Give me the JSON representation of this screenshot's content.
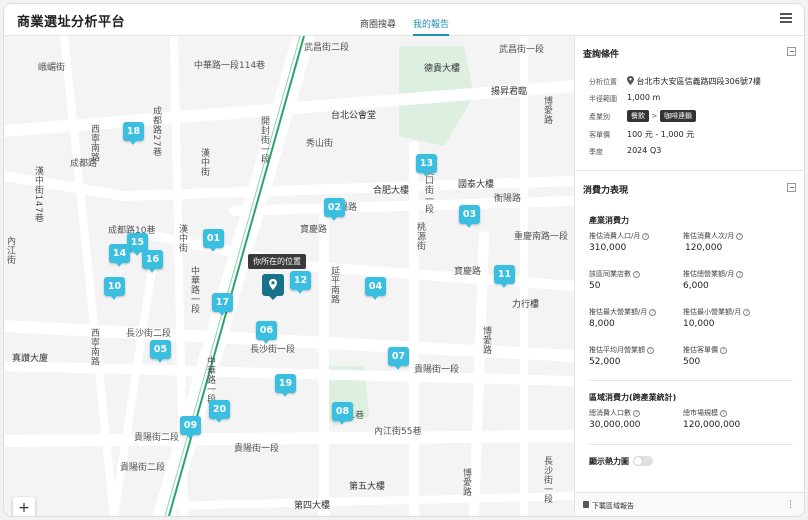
{
  "header": {
    "brand": "商業選址分析平台",
    "tabs": [
      {
        "label": "商圈搜尋",
        "active": false
      },
      {
        "label": "我的報告",
        "active": true
      }
    ]
  },
  "map": {
    "markers": [
      "18",
      "13",
      "02",
      "03",
      "01",
      "15",
      "14",
      "16",
      "12",
      "04",
      "11",
      "10",
      "17",
      "06",
      "05",
      "07",
      "19",
      "20",
      "09",
      "08"
    ],
    "you_are_here": "你所在的位置",
    "pois": [
      "德貴大樓",
      "揚昇君臨",
      "台北公會堂",
      "合肥大樓",
      "國泰大樓",
      "力行樓",
      "真讚大廈",
      "第五大樓",
      "第四大樓"
    ],
    "streets": [
      "峨嵋街",
      "中華路一段114巷",
      "武昌街一段",
      "成都路",
      "成都路27巷",
      "寶慶路",
      "衡陽路",
      "秀山街",
      "延平南路",
      "長沙街一段",
      "長沙街二段",
      "貴陽街一段",
      "貴陽街二段",
      "博愛路",
      "重慶南路一段",
      "西寧南路",
      "漢中街",
      "內江街",
      "開封街一段",
      "中華路一段",
      "武昌街二段",
      "桃源街",
      "漢口街一段",
      "延平南路",
      "121巷",
      "懷寧街",
      "長沙街一段",
      "貴陽街一段",
      "內江街55巷",
      "成都路10巷",
      "漢中街147巷"
    ],
    "zoom_in": "+",
    "zoom_out": "−"
  },
  "query": {
    "title": "查詢條件",
    "location_label": "分析位置",
    "location_value": "台北市大安區信義路四段306號7樓",
    "radius_label": "半徑範圍",
    "radius_value": "1,000 m",
    "industry_label": "產業別",
    "industry_chip1": "餐飲",
    "industry_sep": ">",
    "industry_chip2": "咖啡連鎖",
    "price_label": "客單價",
    "price_value": "100 元 - 1,000 元",
    "season_label": "季度",
    "season_value": "2024 Q3"
  },
  "consumption": {
    "title": "消費力表現",
    "industry_sub": "產業消費力",
    "metrics": [
      {
        "label": "推估消費人口/月",
        "value": "310,000"
      },
      {
        "label": "推估消費人次/月",
        "value": "120,000"
      },
      {
        "label": "該區同業店數",
        "value": "50"
      },
      {
        "label": "推估總營業額/月",
        "value": "6,000"
      },
      {
        "label": "推估最大營業額/月",
        "value": "8,000"
      },
      {
        "label": "推估最小營業額/月",
        "value": "10,000"
      },
      {
        "label": "推估平均月營業額",
        "value": "52,000"
      },
      {
        "label": "推估客單價",
        "value": "500"
      }
    ],
    "region_sub": "區域消費力(跨產業統計)",
    "region_metrics": [
      {
        "label": "總消費人口數",
        "value": "30,000,000"
      },
      {
        "label": "總市場規模",
        "value": "120,000,000"
      }
    ],
    "heatmap_label": "顯示熱力圖"
  },
  "footer": {
    "download_label": "下載區域報告",
    "more": "⋮"
  },
  "icons": {
    "menu": "menu-icon",
    "pin": "location-pin-icon",
    "collapse": "collapse-icon",
    "help": "help-icon",
    "download": "document-icon",
    "more": "more-vertical-icon"
  },
  "colors": {
    "accent": "#1f8fb5",
    "marker": "#3bbfe0",
    "you_pin": "#17738c",
    "park": "#dcefe0",
    "road": "#ffffff",
    "metro_line": "#2ba36b"
  }
}
